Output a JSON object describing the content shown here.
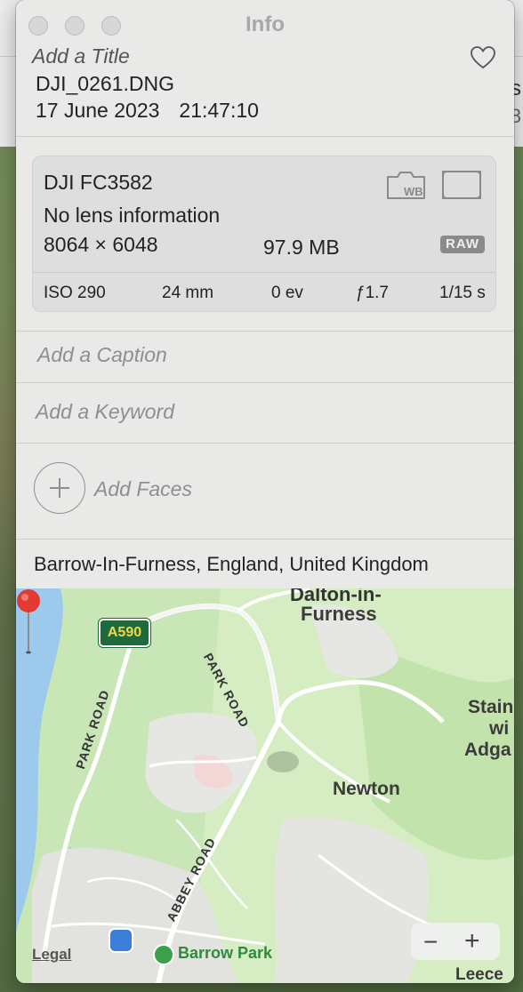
{
  "background": {
    "peek_text_1": "s",
    "peek_text_2": "8"
  },
  "window": {
    "title": "Info",
    "traffic_lights": [
      "close",
      "minimize",
      "zoom"
    ]
  },
  "header": {
    "title_placeholder": "Add a Title",
    "filename": "DJI_0261.DNG",
    "date": "17 June 2023",
    "time": "21:47:10",
    "favorite_icon": "heart-outline-icon"
  },
  "camera_info": {
    "model": "DJI FC3582",
    "lens": "No lens information",
    "dimensions": "8064 × 6048",
    "file_size": "97.9 MB",
    "format_badge": "RAW",
    "icons": [
      "white-balance-camera-icon",
      "frame-icon"
    ],
    "exif": {
      "iso": "ISO 290",
      "focal_length": "24 mm",
      "exposure_bias": "0 ev",
      "aperture": "ƒ1.7",
      "shutter": "1/15 s"
    }
  },
  "fields": {
    "caption_placeholder": "Add a Caption",
    "keyword_placeholder": "Add a Keyword",
    "faces_label": "Add Faces"
  },
  "location": {
    "text": "Barrow-In-Furness, England, United Kingdom"
  },
  "map": {
    "labels": {
      "dalton_line1": "Dalton-in-",
      "dalton_line2": "Furness",
      "park_road_1": "PARK ROAD",
      "park_road_2": "PARK ROAD",
      "abbey_road": "ABBEY ROAD",
      "newton": "Newton",
      "stain_1": "Stain",
      "stain_2": "wi",
      "stain_3": "Adga",
      "barrow_park": "Barrow Park",
      "leece": "Leece"
    },
    "road_badge": "A590",
    "legal": "Legal",
    "zoom_out": "−",
    "zoom_in": "+"
  }
}
